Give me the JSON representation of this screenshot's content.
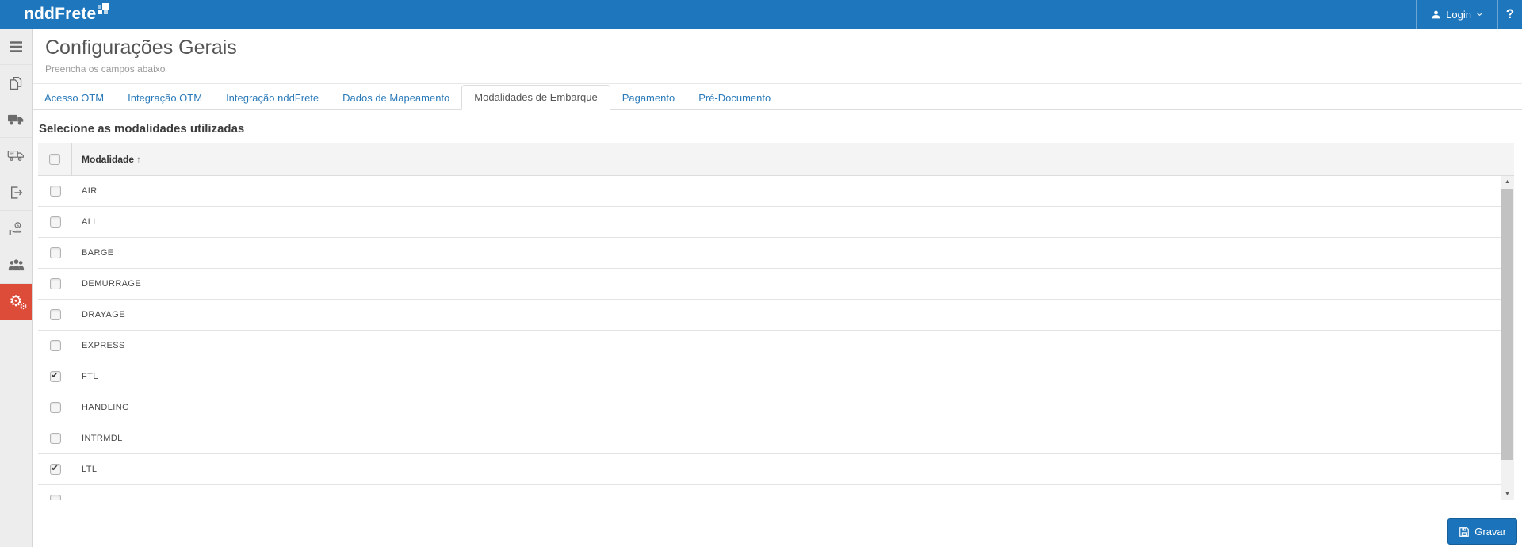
{
  "topbar": {
    "logo_text": "nddFrete",
    "login_label": "Login",
    "help_label": "?"
  },
  "sidebar": {
    "items": [
      {
        "name": "menu",
        "icon": "menu-icon",
        "active": false
      },
      {
        "name": "documents",
        "icon": "copy-icon",
        "active": false
      },
      {
        "name": "truck",
        "icon": "truck-icon",
        "active": false
      },
      {
        "name": "delivery",
        "icon": "truck-outline-icon",
        "active": false
      },
      {
        "name": "export",
        "icon": "document-export-icon",
        "active": false
      },
      {
        "name": "payment",
        "icon": "money-hand-icon",
        "active": false
      },
      {
        "name": "users",
        "icon": "users-icon",
        "active": false
      },
      {
        "name": "settings",
        "icon": "gears-icon",
        "active": true
      }
    ]
  },
  "page": {
    "title": "Configurações Gerais",
    "subtitle": "Preencha os campos abaixo"
  },
  "tabs": {
    "items": [
      {
        "label": "Acesso OTM",
        "active": false
      },
      {
        "label": "Integração OTM",
        "active": false
      },
      {
        "label": "Integração nddFrete",
        "active": false
      },
      {
        "label": "Dados de Mapeamento",
        "active": false
      },
      {
        "label": "Modalidades de Embarque",
        "active": true
      },
      {
        "label": "Pagamento",
        "active": false
      },
      {
        "label": "Pré-Documento",
        "active": false
      }
    ]
  },
  "section": {
    "title": "Selecione as modalidades utilizadas"
  },
  "table": {
    "column_header": "Modalidade",
    "sort_indicator": "↑",
    "rows": [
      {
        "label": "AIR",
        "checked": false
      },
      {
        "label": "ALL",
        "checked": false
      },
      {
        "label": "BARGE",
        "checked": false
      },
      {
        "label": "DEMURRAGE",
        "checked": false
      },
      {
        "label": "DRAYAGE",
        "checked": false
      },
      {
        "label": "EXPRESS",
        "checked": false
      },
      {
        "label": "FTL",
        "checked": true
      },
      {
        "label": "HANDLING",
        "checked": false
      },
      {
        "label": "INTRMDL",
        "checked": false
      },
      {
        "label": "LTL",
        "checked": true
      },
      {
        "label": "",
        "checked": false
      }
    ]
  },
  "footer": {
    "save_label": "Gravar"
  },
  "colors": {
    "topbar_blue": "#1e76bd",
    "accent_red": "#dd4b39",
    "link_blue": "#2a7ab9",
    "button_blue": "#1b74bb"
  }
}
